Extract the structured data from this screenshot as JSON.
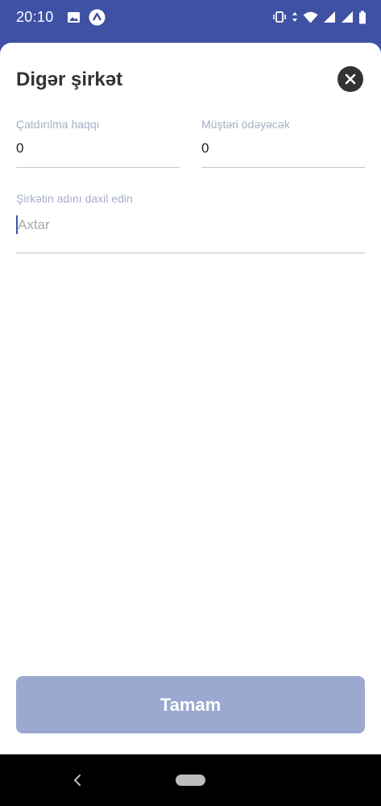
{
  "status_bar": {
    "time": "20:10",
    "left_icons": [
      "image-icon",
      "expo-icon"
    ],
    "right_icons": [
      "vibrate-icon",
      "data-arrows-icon",
      "wifi-icon",
      "signal-icon",
      "signal-icon-2",
      "battery-icon"
    ]
  },
  "sheet": {
    "title": "Digər şirkət",
    "close_icon": "close-icon",
    "delivery_fee": {
      "label": "Çatdırılma haqqı",
      "value": "0"
    },
    "customer_pays": {
      "label": "Müştəri ödəyəcək",
      "value": "0"
    },
    "company_search": {
      "label": "Şirkətin adını daxil edin",
      "placeholder": "Axtar",
      "value": ""
    },
    "done_label": "Tamam"
  },
  "colors": {
    "brand": "#3f51a5",
    "button_disabled": "#9ba8cf",
    "label": "#a4aec4"
  },
  "nav_bar": {
    "icons": [
      "back-icon",
      "home-pill-icon"
    ]
  }
}
